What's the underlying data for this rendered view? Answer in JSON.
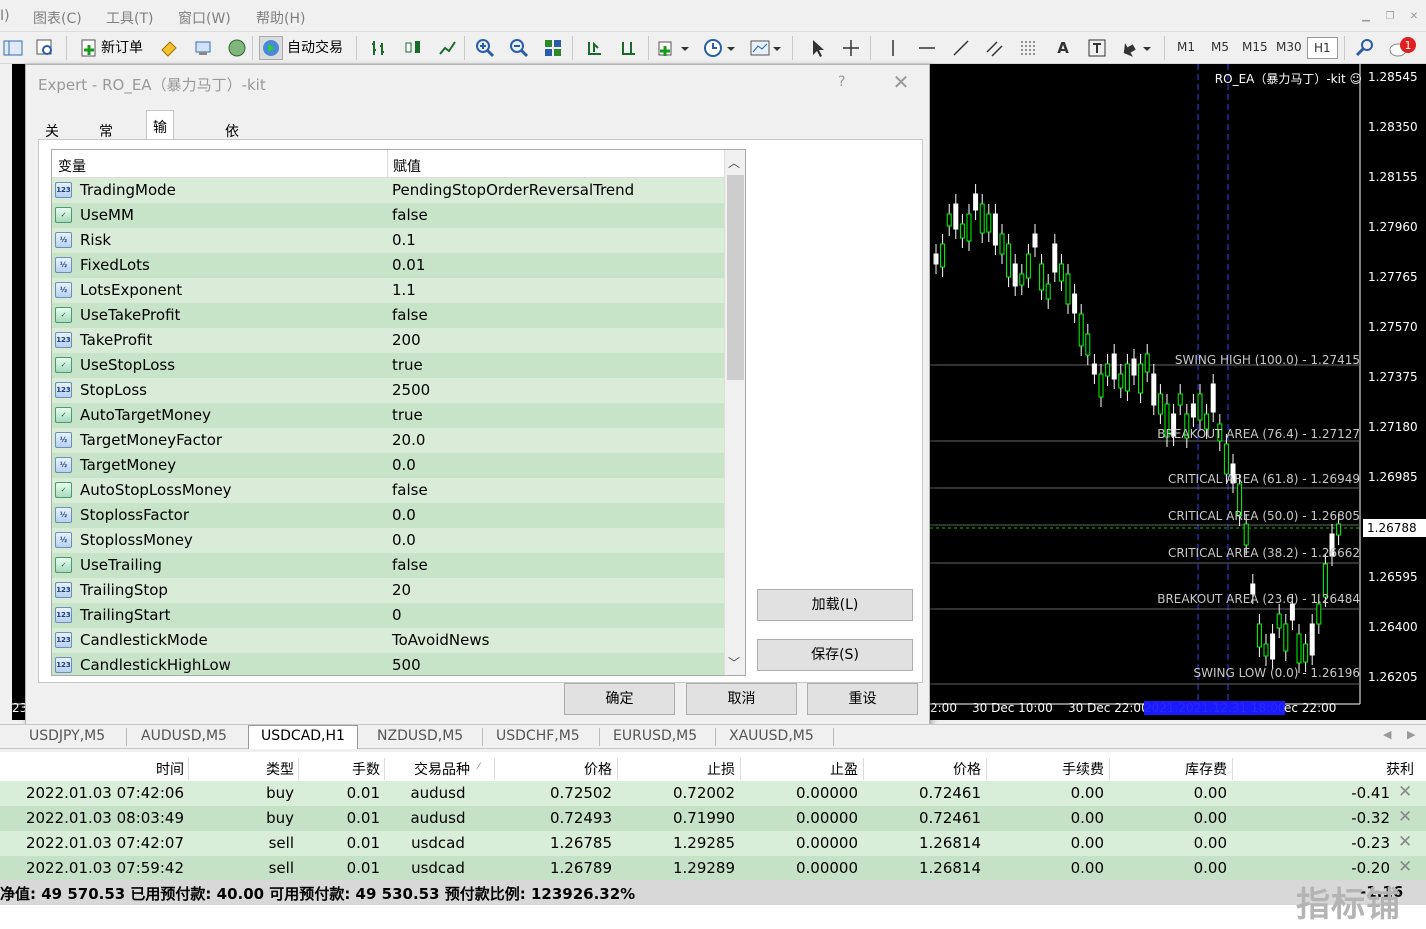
{
  "menu": {
    "items": [
      "I)",
      "图表(C)",
      "工具(T)",
      "窗口(W)",
      "帮助(H)"
    ]
  },
  "toolbar": {
    "new_order": "新订单",
    "auto_trade": "自动交易",
    "timeframes": [
      "M1",
      "M5",
      "M15",
      "M30",
      "H1"
    ],
    "active_timeframe": "H1",
    "notification_count": "1"
  },
  "chart": {
    "title": "RO_EA（暴力马丁）-kit ☺",
    "current_price": "1.26788",
    "price_ticks": [
      "1.28545",
      "1.28350",
      "1.28155",
      "1.27960",
      "1.27765",
      "1.27570",
      "1.27375",
      "1.27180",
      "1.26985",
      "1.26595",
      "1.26400",
      "1.26205"
    ],
    "fib_levels": [
      "SWING HIGH (100.0) - 1.27415",
      "BREAKOUT AREA (76.4) - 1.27127",
      "CRITICAL AREA (61.8) - 1.26949",
      "CRITICAL AREA (50.0) - 1.26805",
      "CRITICAL AREA (38.2) - 1.26662",
      "BREAKOUT AREA (23.6) - 1.26484",
      "SWING LOW (0.0) - 1.26196"
    ],
    "time_labels": [
      "23",
      "2:00",
      "30 Dec 10:00",
      "30 Dec 22:00",
      "2021.2021.12.31 18:00",
      "ec 22:00"
    ],
    "colors": {
      "background": "#000000",
      "bull": "#00ff00",
      "line": "#ffffff"
    }
  },
  "dialog": {
    "title": "Expert - RO_EA（暴力马丁）-kit",
    "help": "?",
    "close": "✕",
    "tabs": [
      "关于",
      "常用",
      "输入参数",
      "依存关系"
    ],
    "active_tab": "输入参数",
    "columns": {
      "variable": "变量",
      "value": "赋值"
    },
    "params": [
      {
        "type": "123",
        "name": "TradingMode",
        "value": "PendingStopOrderReversalTrend"
      },
      {
        "type": "bool",
        "name": "UseMM",
        "value": "false"
      },
      {
        "type": "v2",
        "name": "Risk",
        "value": "0.1"
      },
      {
        "type": "v2",
        "name": "FixedLots",
        "value": "0.01"
      },
      {
        "type": "v2",
        "name": "LotsExponent",
        "value": "1.1"
      },
      {
        "type": "bool",
        "name": "UseTakeProfit",
        "value": "false"
      },
      {
        "type": "123",
        "name": "TakeProfit",
        "value": "200"
      },
      {
        "type": "bool",
        "name": "UseStopLoss",
        "value": "true"
      },
      {
        "type": "123",
        "name": "StopLoss",
        "value": "2500"
      },
      {
        "type": "bool",
        "name": "AutoTargetMoney",
        "value": "true"
      },
      {
        "type": "v2",
        "name": "TargetMoneyFactor",
        "value": "20.0"
      },
      {
        "type": "v2",
        "name": "TargetMoney",
        "value": "0.0"
      },
      {
        "type": "bool",
        "name": "AutoStopLossMoney",
        "value": "false"
      },
      {
        "type": "v2",
        "name": "StoplossFactor",
        "value": "0.0"
      },
      {
        "type": "v2",
        "name": "StoplossMoney",
        "value": "0.0"
      },
      {
        "type": "bool",
        "name": "UseTrailing",
        "value": "false"
      },
      {
        "type": "123",
        "name": "TrailingStop",
        "value": "20"
      },
      {
        "type": "123",
        "name": "TrailingStart",
        "value": "0"
      },
      {
        "type": "123",
        "name": "CandlestickMode",
        "value": "ToAvoidNews"
      },
      {
        "type": "123",
        "name": "CandlestickHighLow",
        "value": "500"
      }
    ],
    "load_button": "加载(L)",
    "save_button": "保存(S)",
    "ok_button": "确定",
    "cancel_button": "取消",
    "reset_button": "重设"
  },
  "symbol_tabs": [
    "USDJPY,M5",
    "AUDUSD,M5",
    "USDCAD,H1",
    "NZDUSD,M5",
    "USDCHF,M5",
    "EURUSD,M5",
    "XAUUSD,M5"
  ],
  "active_symbol_tab": "USDCAD,H1",
  "orders": {
    "headers": [
      "时间",
      "类型",
      "手数",
      "交易品种",
      "价格",
      "止损",
      "止盈",
      "价格",
      "手续费",
      "库存费",
      "获利"
    ],
    "rows": [
      [
        "2022.01.03 07:42:06",
        "buy",
        "0.01",
        "audusd",
        "0.72502",
        "0.72002",
        "0.00000",
        "0.72461",
        "0.00",
        "0.00",
        "-0.41"
      ],
      [
        "2022.01.03 08:03:49",
        "buy",
        "0.01",
        "audusd",
        "0.72493",
        "0.71990",
        "0.00000",
        "0.72461",
        "0.00",
        "0.00",
        "-0.32"
      ],
      [
        "2022.01.03 07:42:07",
        "sell",
        "0.01",
        "usdcad",
        "1.26785",
        "1.29285",
        "0.00000",
        "1.26814",
        "0.00",
        "0.00",
        "-0.23"
      ],
      [
        "2022.01.03 07:59:42",
        "sell",
        "0.01",
        "usdcad",
        "1.26789",
        "1.29289",
        "0.00000",
        "1.26814",
        "0.00",
        "0.00",
        "-0.20"
      ]
    ],
    "balance_line": "净值: 49 570.53  已用预付款: 40.00  可用预付款: 49 530.53  预付款比例: 123926.32%",
    "balance_total": "-1.16"
  },
  "watermark": "指标铺"
}
